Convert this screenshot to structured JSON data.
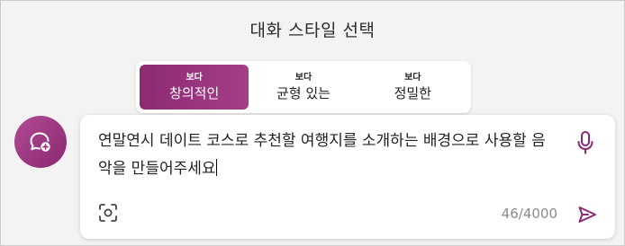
{
  "header": {
    "title": "대화 스타일 선택"
  },
  "styles": [
    {
      "prefix": "보다",
      "label": "창의적인",
      "active": true
    },
    {
      "prefix": "보다",
      "label": "균형 있는",
      "active": false
    },
    {
      "prefix": "보다",
      "label": "정밀한",
      "active": false
    }
  ],
  "composer": {
    "text": "연말연시 데이트 코스로 추천할 여행지를 소개하는 배경으로 사용할 음악을 만들어주세요",
    "char_count": "46/4000"
  },
  "icons": {
    "avatar": "chat-add-icon",
    "mic": "microphone-icon",
    "camera": "visual-search-icon",
    "send": "send-icon"
  },
  "colors": {
    "accent": "#8c2a74",
    "accent_light": "#a43f86"
  }
}
